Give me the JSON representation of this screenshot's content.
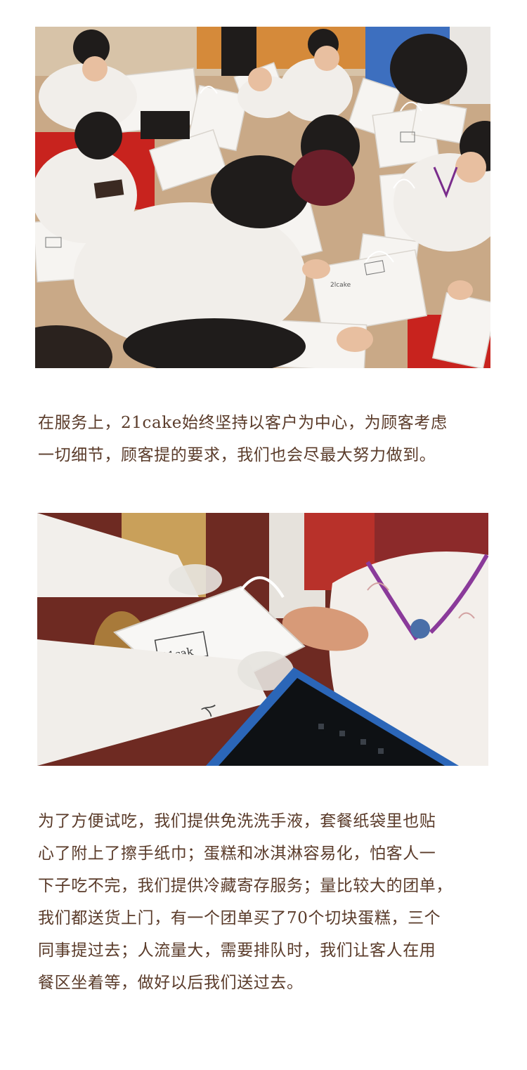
{
  "photos": [
    {
      "depicts": "people in white hoodies packing white paper bags on the floor",
      "bag_label": "2lcake"
    },
    {
      "depicts": "gloved hands holding an open 21cake paper bag over a tablet",
      "bag_label": "21cak"
    }
  ],
  "paragraphs": [
    {
      "lines": [
        "在服务上，21cake始终坚持以客户为中心，为顾客考虑",
        "一切细节，顾客提的要求，我们也会尽最大努力做到。"
      ]
    },
    {
      "lines": [
        "为了方便试吃，我们提供免洗洗手液，套餐纸袋里也贴",
        "心了附上了擦手纸巾；蛋糕和冰淇淋容易化，怕客人一",
        "下子吃不完，我们提供冷藏寄存服务；量比较大的团单，",
        "我们都送货上门，有一个团单买了70个切块蛋糕，三个",
        "同事提过去；人流量大，需要排队时，我们让客人在用",
        "餐区坐着等，做好以后我们送过去。"
      ]
    }
  ],
  "colors": {
    "text": "#5a3b2a",
    "background": "#ffffff",
    "floor_red": "#c8231e",
    "cardboard": "#c9a987",
    "hoodie_white": "#f1eeea",
    "tablet_blue": "#2b66b8"
  }
}
